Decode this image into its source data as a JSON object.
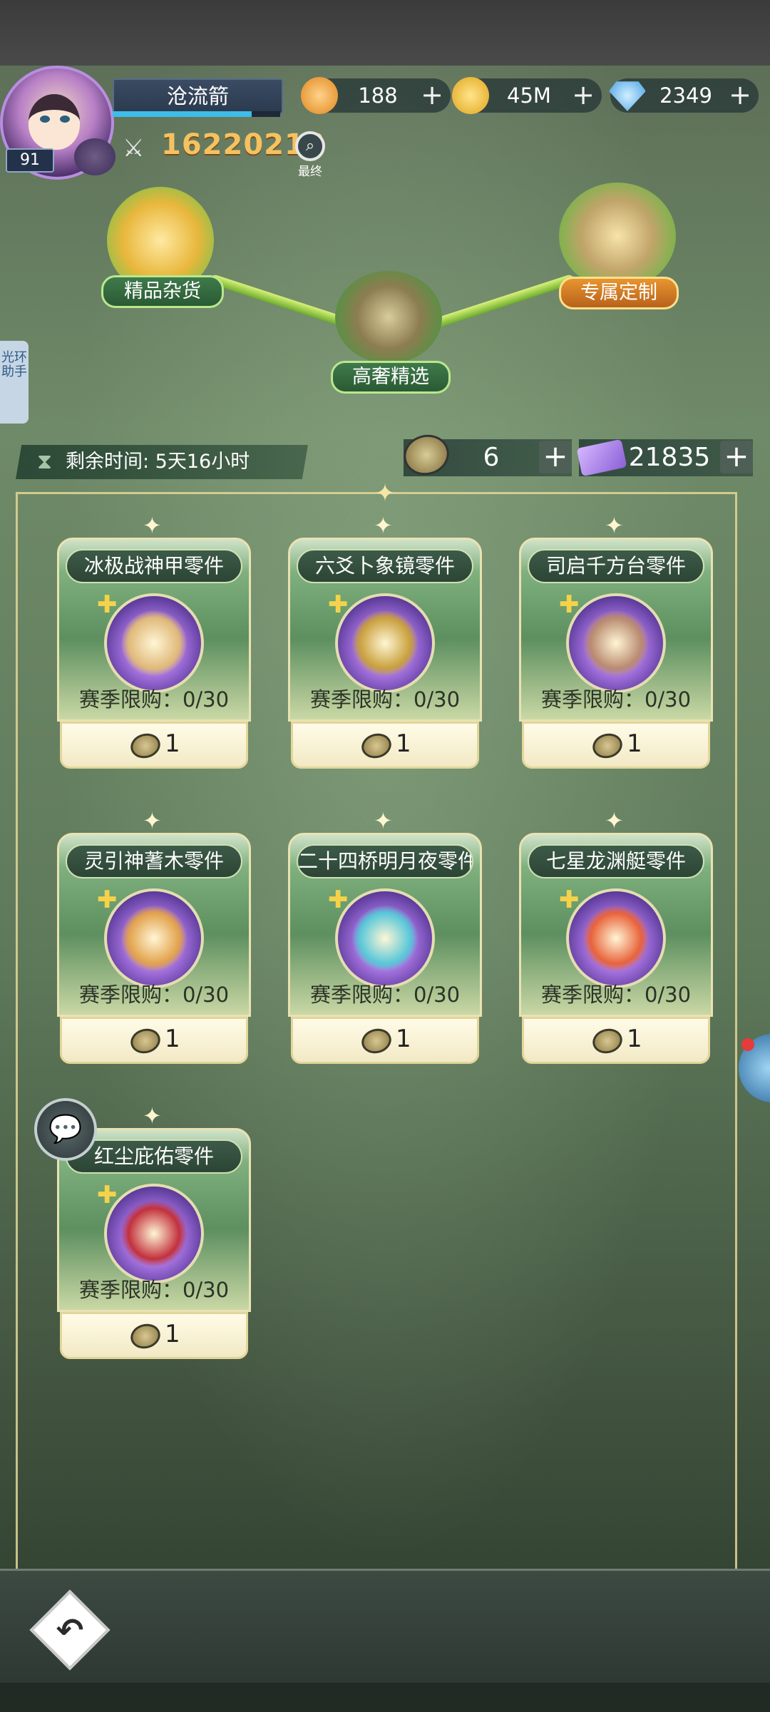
{
  "player": {
    "name": "沧流箭",
    "level": "91",
    "exp_fraction": 0.83,
    "power": "16220213",
    "final_label": "最终"
  },
  "currencies": [
    {
      "id": "orange-coin",
      "value": "188",
      "icon": "orange-token-icon",
      "color": "#f0a340"
    },
    {
      "id": "gold",
      "value": "45M",
      "icon": "gold-coin-icon",
      "color": "#f5c02c"
    },
    {
      "id": "diamond",
      "value": "2349",
      "icon": "diamond-icon",
      "color": "#5bb9f5"
    }
  ],
  "categories": [
    {
      "label": "精品杂货",
      "style": "green"
    },
    {
      "label": "高奢精选",
      "style": "green"
    },
    {
      "label": "专属定制",
      "style": "orange"
    }
  ],
  "side_tab": {
    "label": "光环助手"
  },
  "timer": {
    "label": "剩余时间: 5天16小时"
  },
  "shop_currencies": [
    {
      "value": "6",
      "icon": "medal-coin-icon"
    },
    {
      "value": "21835",
      "icon": "purple-ticket-icon"
    }
  ],
  "items": [
    {
      "name": "冰极战神甲零件",
      "limit": "赛季限购：0/30",
      "price": "1",
      "art_color": "#e0b97a"
    },
    {
      "name": "六爻卜象镜零件",
      "limit": "赛季限购：0/30",
      "price": "1",
      "art_color": "#c9a03c"
    },
    {
      "name": "司启千方台零件",
      "limit": "赛季限购：0/30",
      "price": "1",
      "art_color": "#b98a70"
    },
    {
      "name": "灵引神蓍木零件",
      "limit": "赛季限购：0/30",
      "price": "1",
      "art_color": "#e2a24c"
    },
    {
      "name": "二十四桥明月夜零件",
      "limit": "赛季限购：0/30",
      "price": "1",
      "art_color": "#58c7d8"
    },
    {
      "name": "七星龙渊艇零件",
      "limit": "赛季限购：0/30",
      "price": "1",
      "art_color": "#e8623a"
    },
    {
      "name": "红尘庇佑零件",
      "limit": "赛季限购：0/30",
      "price": "1",
      "art_color": "#c2303c"
    }
  ]
}
